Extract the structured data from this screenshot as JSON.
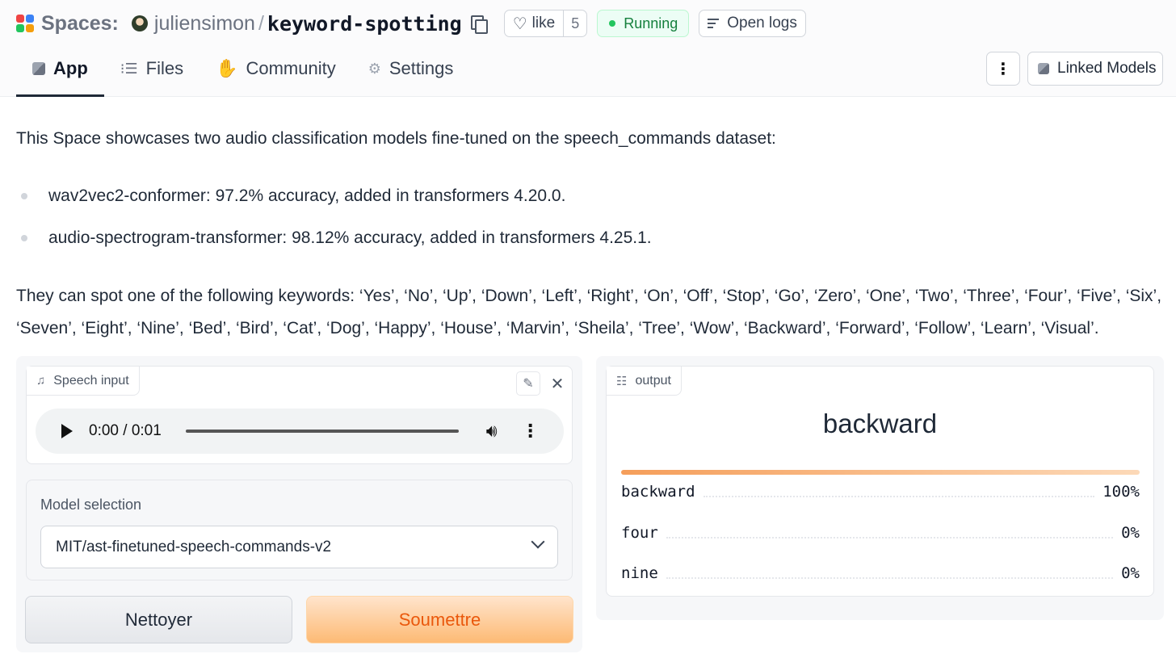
{
  "header": {
    "spaces_label": "Spaces:",
    "owner": "juliensimon",
    "separator": "/",
    "repo": "keyword-spotting",
    "like_label": "like",
    "like_count": "5",
    "status": "Running",
    "open_logs": "Open logs",
    "logo_colors": [
      "#ef4444",
      "#3b82f6",
      "#22c55e",
      "#f59e0b"
    ]
  },
  "tabs": [
    {
      "label": "App",
      "icon": "cube-icon"
    },
    {
      "label": "Files",
      "icon": "files-icon"
    },
    {
      "label": "Community",
      "icon": "community-icon"
    },
    {
      "label": "Settings",
      "icon": "gear-icon"
    }
  ],
  "actions": {
    "menu_icon": "⋮",
    "linked_models": "Linked Models"
  },
  "description": {
    "intro": "This Space showcases two audio classification models fine-tuned on the speech_commands dataset:",
    "bullets": [
      "wav2vec2-conformer: 97.2% accuracy, added in transformers 4.20.0.",
      "audio-spectrogram-transformer: 98.12% accuracy, added in transformers 4.25.1."
    ],
    "keywords": "They can spot one of the following keywords: ‘Yes’, ‘No’, ‘Up’, ‘Down’, ‘Left’, ‘Right’, ‘On’, ‘Off’, ‘Stop’, ‘Go’, ‘Zero’, ‘One’, ‘Two’, ‘Three’, ‘Four’, ‘Five’, ‘Six’, ‘Seven’, ‘Eight’, ‘Nine’, ‘Bed’, ‘Bird’, ‘Cat’, ‘Dog’, ‘Happy’, ‘House’, ‘Marvin’, ‘Sheila’, ‘Tree’, ‘Wow’, ‘Backward’, ‘Forward’, ‘Follow’, ‘Learn’, ‘Visual’."
  },
  "input": {
    "label": "Speech input",
    "time": "0:00 / 0:01",
    "model_label": "Model selection",
    "model_value": "MIT/ast-finetuned-speech-commands-v2",
    "clear_button": "Nettoyer",
    "submit_button": "Soumettre"
  },
  "output": {
    "label": "output",
    "top_label": "backward",
    "confidences": [
      {
        "label": "backward",
        "value": "100%"
      },
      {
        "label": "four",
        "value": "0%"
      },
      {
        "label": "nine",
        "value": "0%"
      }
    ]
  }
}
